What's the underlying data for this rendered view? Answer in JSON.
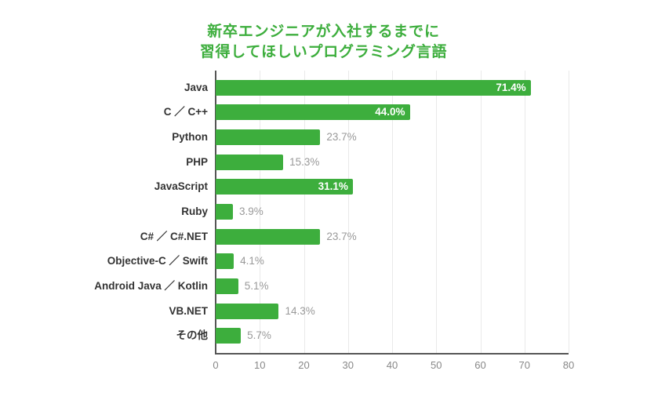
{
  "chart_data": {
    "type": "bar",
    "orientation": "horizontal",
    "title_lines": [
      "新卒エンジニアが入社するまでに",
      "習得してほしいプログラミング言語"
    ],
    "categories": [
      "Java",
      "C ／ C++",
      "Python",
      "PHP",
      "JavaScript",
      "Ruby",
      "C# ／ C#.NET",
      "Objective-C ／ Swift",
      "Android Java ／ Kotlin",
      "VB.NET",
      "その他"
    ],
    "values": [
      71.4,
      44.0,
      23.7,
      15.3,
      31.1,
      3.9,
      23.7,
      4.1,
      5.1,
      14.3,
      5.7
    ],
    "value_labels": [
      "71.4%",
      "44.0%",
      "23.7%",
      "15.3%",
      "31.1%",
      "3.9%",
      "23.7%",
      "4.1%",
      "5.1%",
      "14.3%",
      "5.7%"
    ],
    "label_inside": [
      true,
      true,
      false,
      false,
      true,
      false,
      false,
      false,
      false,
      false,
      false
    ],
    "xlabel": "",
    "ylabel": "",
    "xlim": [
      0,
      80
    ],
    "xticks": [
      0,
      10,
      20,
      30,
      40,
      50,
      60,
      70,
      80
    ],
    "colors": {
      "bar": "#3dae3d",
      "title": "#3dae3d"
    }
  }
}
